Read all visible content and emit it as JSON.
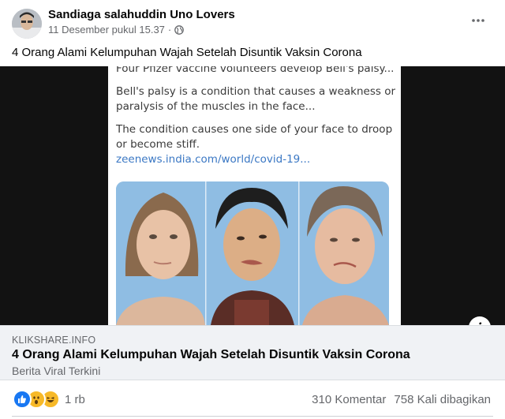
{
  "post": {
    "author": "Sandiaga salahuddin Uno Lovers",
    "timestamp": "11 Desember pukul 15.37",
    "separator": "·",
    "privacy_icon": "globe-icon",
    "more_icon": "more-options-icon",
    "caption": "4 Orang Alami Kelumpuhan Wajah Setelah Disuntik Vaksin Corona"
  },
  "media": {
    "lines": [
      "Four Pfizer vaccine volunteers develop Bell's palsy...",
      "Bell's palsy is a condition that causes a weakness or paralysis of the muscles in the face...",
      "The condition causes one side of your face to droop or become stiff."
    ],
    "link_text": "zeenews.india.com/world/covid-19..."
  },
  "link_preview": {
    "domain": "KLIKSHARE.INFO",
    "title": "4 Orang Alami Kelumpuhan Wajah Setelah Disuntik Vaksin Corona",
    "subtitle": "Berita Viral Terkini",
    "info_label": "i"
  },
  "stats": {
    "reaction_icons": [
      "like-icon",
      "wow-icon",
      "haha-icon"
    ],
    "reaction_count": "1 rb",
    "comments": "310 Komentar",
    "shares": "758 Kali dibagikan"
  },
  "colors": {
    "like_blue": "#1877f2",
    "reaction_yellow": "#f7b928",
    "link_blue": "#3b78c4"
  }
}
